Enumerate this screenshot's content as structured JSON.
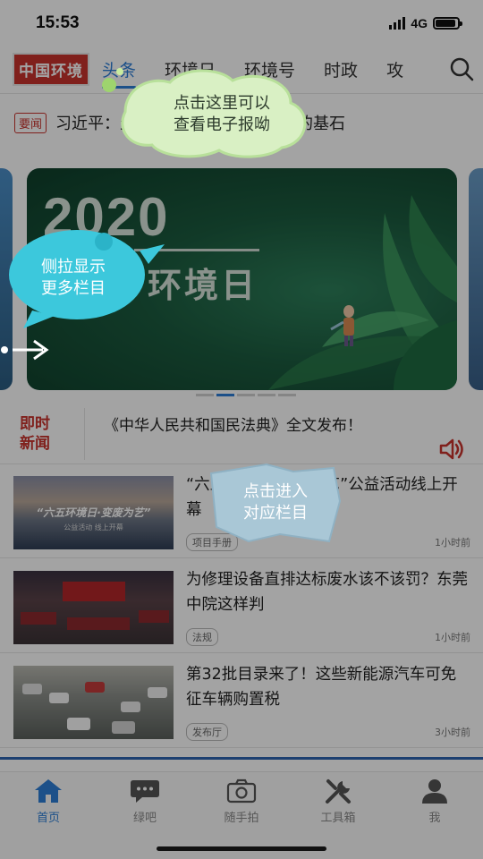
{
  "status_bar": {
    "time": "15:53",
    "network": "4G"
  },
  "nav": {
    "logo": "中国环境",
    "tabs": [
      "头条",
      "环境日",
      "环境号",
      "时政",
      "攻"
    ]
  },
  "headline": {
    "badge": "要闻",
    "text": "习近平：生态文明建设是美丽中国的基石"
  },
  "banner": {
    "year": "2020",
    "title": "环境日"
  },
  "flash": {
    "label_line1": "即时",
    "label_line2": "新闻",
    "text": "《中华人民共和国民法典》全文发布！"
  },
  "news": [
    {
      "title": "“六五环境日·变废为艺”公益活动线上开幕",
      "tag": "项目手册",
      "time": "1小时前",
      "image_caption": "“六五环境日·变废为艺”",
      "image_sub": "公益活动 线上开幕"
    },
    {
      "title": "为修理设备直排达标废水该不该罚？东莞中院这样判",
      "tag": "法规",
      "time": "1小时前"
    },
    {
      "title": "第32批目录来了！这些新能源汽车可免征车辆购置税",
      "tag": "发布厅",
      "time": "3小时前"
    }
  ],
  "tabbar": [
    {
      "label": "首页",
      "icon": "home-icon",
      "active": true
    },
    {
      "label": "绿吧",
      "icon": "chat-bubble-icon",
      "active": false
    },
    {
      "label": "随手拍",
      "icon": "camera-icon",
      "active": false
    },
    {
      "label": "工具箱",
      "icon": "tools-icon",
      "active": false
    },
    {
      "label": "我",
      "icon": "user-icon",
      "active": false
    }
  ],
  "overlay": {
    "hint_top": "点击这里可以\n查看电子报呦",
    "hint_left": "侧拉显示\n更多栏目",
    "hint_mid": "点击进入\n对应栏目"
  },
  "colors": {
    "accent": "#2c7ed6",
    "brand_red": "#c8322d"
  }
}
